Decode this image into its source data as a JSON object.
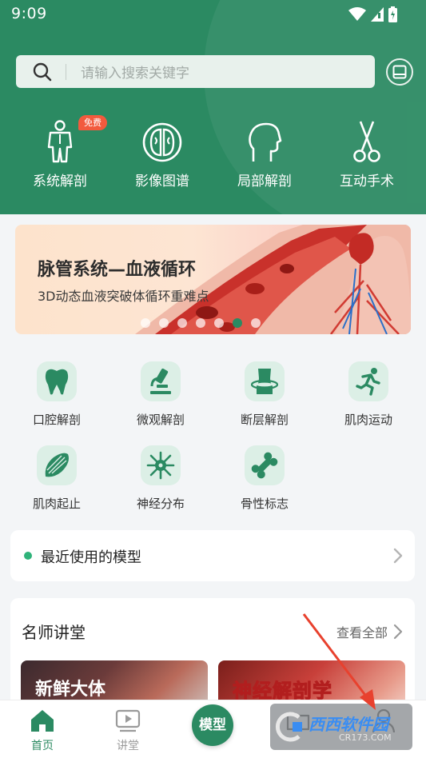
{
  "status_bar": {
    "time": "9:09"
  },
  "search": {
    "placeholder": "请输入搜索关键字"
  },
  "quick_actions": [
    {
      "label": "系统解剖",
      "icon": "human-body-icon",
      "badge": "免费"
    },
    {
      "label": "影像图谱",
      "icon": "brain-scan-icon"
    },
    {
      "label": "局部解剖",
      "icon": "head-profile-icon"
    },
    {
      "label": "互动手术",
      "icon": "surgical-scissors-icon"
    }
  ],
  "banner": {
    "title": "脉管系统—血液循环",
    "subtitle": "3D动态血液突破体循环重难点",
    "slide_count": 7,
    "active_slide_index": 5
  },
  "features": [
    {
      "label": "口腔解剖",
      "icon": "tooth-icon"
    },
    {
      "label": "微观解剖",
      "icon": "microscope-icon"
    },
    {
      "label": "断层解剖",
      "icon": "body-section-icon"
    },
    {
      "label": "肌肉运动",
      "icon": "running-figure-icon"
    },
    {
      "label": "肌肉起止",
      "icon": "muscle-icon"
    },
    {
      "label": "神经分布",
      "icon": "neuron-icon"
    },
    {
      "label": "骨性标志",
      "icon": "bone-icon"
    }
  ],
  "recent": {
    "label": "最近使用的模型"
  },
  "lecture": {
    "title": "名师讲堂",
    "view_all": "查看全部",
    "items": [
      {
        "title": "新鲜大体"
      },
      {
        "title": "神经解剖学"
      }
    ]
  },
  "bottom_nav": {
    "items": [
      {
        "label": "首页",
        "icon": "home-icon",
        "active": true
      },
      {
        "label": "讲堂",
        "icon": "video-play-icon"
      },
      {
        "label": "模型",
        "icon": "model-button"
      },
      {
        "label": "",
        "icon": "folder-icon"
      },
      {
        "label": "",
        "icon": "user-icon"
      }
    ]
  },
  "watermark": {
    "text": "西西软件园",
    "sub": "CR173.COM"
  },
  "colors": {
    "primary": "#2b8a62",
    "badge": "#f25a3d",
    "icon_bg": "#dcefe6"
  }
}
